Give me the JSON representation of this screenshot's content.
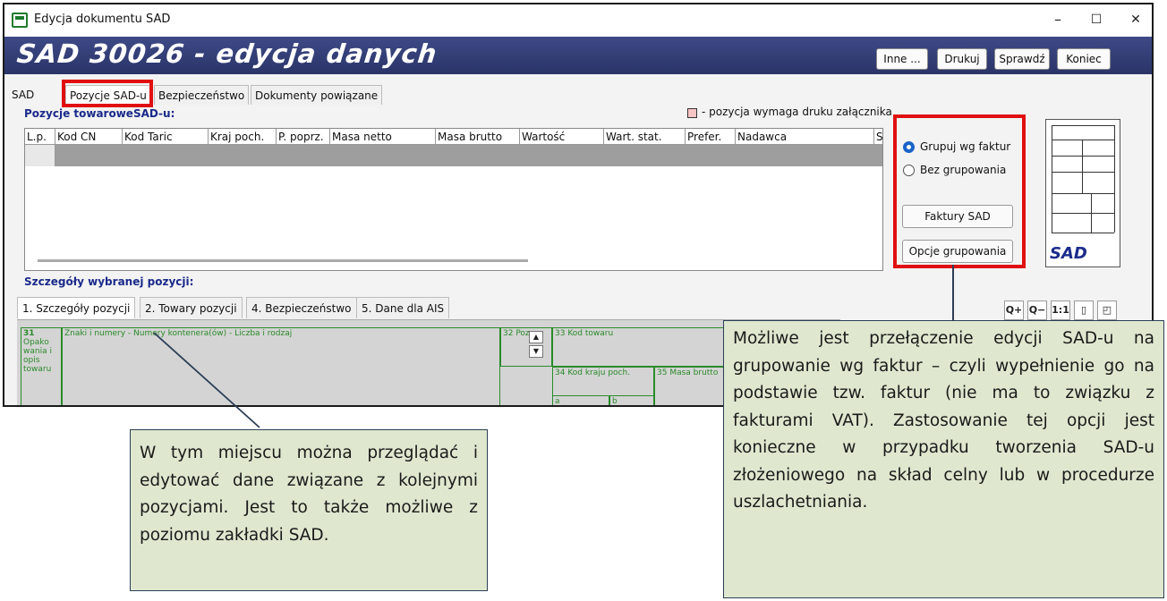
{
  "window": {
    "title": "Edycja dokumentu SAD",
    "controls": {
      "minimize": "–",
      "maximize": "☐",
      "close": "✕"
    }
  },
  "banner": {
    "title": "SAD 30026 - edycja danych",
    "buttons": [
      "Inne ...",
      "Drukuj",
      "Sprawdź",
      "Koniec"
    ]
  },
  "top_tabs": [
    "SAD",
    "Pozycje SAD-u",
    "Bezpieczeństwo",
    "Dokumenty powiązane"
  ],
  "items_section": {
    "title": "Pozycje towaroweSAD-u:",
    "legend": "- pozycja wymaga druku załącznika",
    "columns": [
      "L.p.",
      "Kod CN",
      "Kod Taric",
      "Kraj poch.",
      "P. poprz.",
      "Masa netto",
      "Masa brutto",
      "Wartość",
      "Wart. stat.",
      "Prefer.",
      "Nadawca",
      "Sp"
    ]
  },
  "grouping": {
    "option_invoices": "Grupuj wg faktur",
    "option_none": "Bez grupowania",
    "invoices_button": "Faktury SAD",
    "options_button": "Opcje grupowania"
  },
  "thumbnail": {
    "logo": "SAD"
  },
  "details_section": {
    "title": "Szczegóły wybranej pozycji:",
    "tabs": [
      "1. Szczegóły pozycji",
      "2. Towary pozycji",
      "4. Bezpieczeństwo",
      "5. Dane dla AIS"
    ],
    "toolbar": [
      "Q+",
      "Q−",
      "1:1",
      "▯",
      "◰"
    ]
  },
  "form": {
    "box31_num": "31",
    "box31_label": "Opako wania i opis towaru",
    "box31_header": "Znaki i numery - Numery kontenera(ów) - Liczba i rodzaj",
    "box32": "32 Poz.",
    "box33": "33 Kod towaru",
    "box34": "34 Kod kraju poch.",
    "box34a": "a",
    "box34b": "b",
    "box35": "35 Masa brutto"
  },
  "notes": {
    "left": "W tym miejscu można przeglądać i edytować dane związane z kolejnymi pozycjami. Jest to także możliwe z poziomu zakładki SAD.",
    "right": "Możliwe jest przełączenie edycji SAD-u na grupowanie wg faktur – czyli wypełnienie go na podstawie tzw. faktur (nie ma to związku z fakturami VAT). Zastosowanie tej opcji jest konieczne w przypadku tworzenia SAD-u złożeniowego na skład celny lub w procedurze uszlachetniania."
  }
}
